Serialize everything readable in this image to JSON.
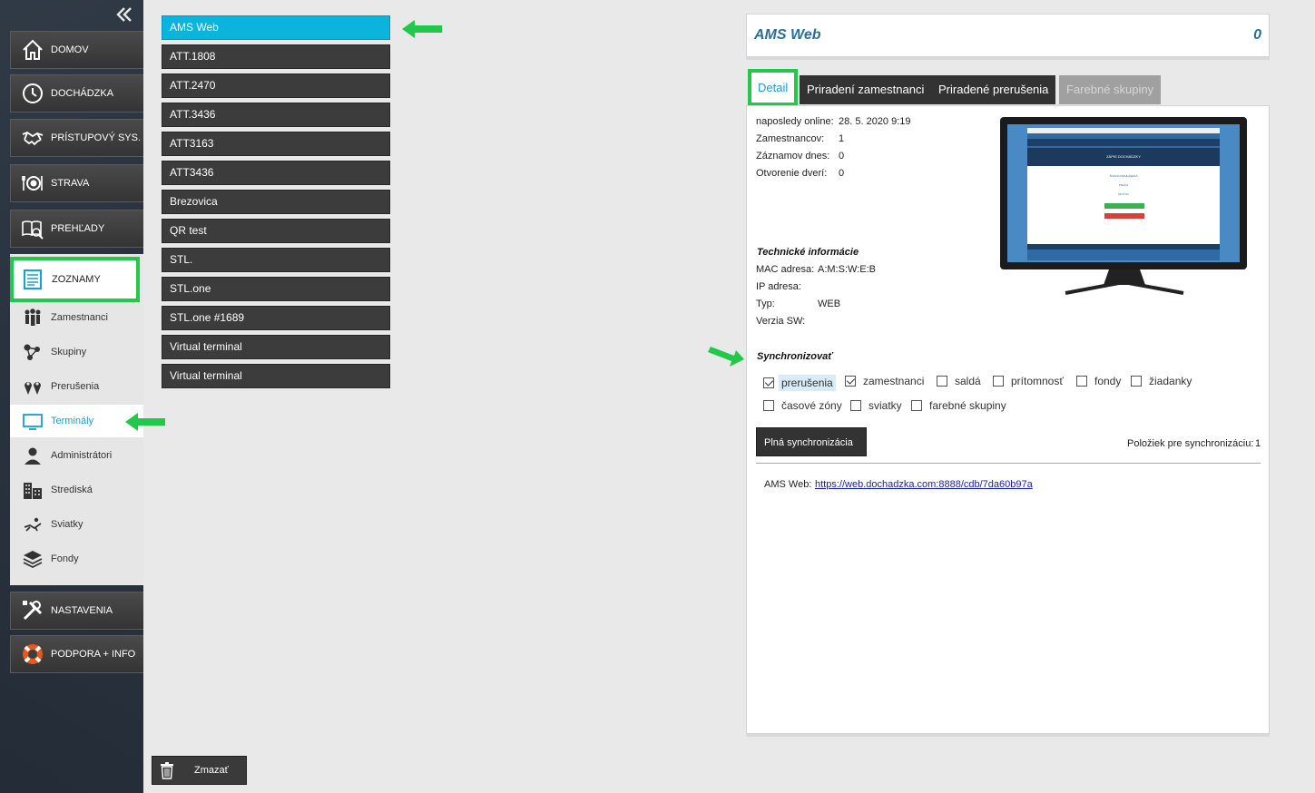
{
  "sidebar": {
    "collapse_icon": "double-chevron-left-icon",
    "nav": [
      {
        "label": "DOMOV",
        "icon": "house-icon"
      },
      {
        "label": "DOCHÁDZKA",
        "icon": "clock-icon"
      },
      {
        "label": "PRÍSTUPOVÝ SYS.",
        "icon": "handshake-icon"
      },
      {
        "label": "STRAVA",
        "icon": "plate-cutlery-icon"
      },
      {
        "label": "PREHĽADY",
        "icon": "book-magnifier-icon"
      }
    ],
    "zoznamy": {
      "label": "ZOZNAMY",
      "icon": "list-document-icon"
    },
    "sub_items": [
      {
        "label": "Zamestnanci",
        "icon": "people-icon"
      },
      {
        "label": "Skupiny",
        "icon": "group-nodes-icon"
      },
      {
        "label": "Prerušenia",
        "icon": "location-pins-icon"
      },
      {
        "label": "Terminály",
        "icon": "monitor-icon"
      },
      {
        "label": "Administrátori",
        "icon": "admin-user-icon"
      },
      {
        "label": "Strediská",
        "icon": "buildings-icon"
      },
      {
        "label": "Sviatky",
        "icon": "lounger-icon"
      },
      {
        "label": "Fondy",
        "icon": "layers-icon"
      }
    ],
    "bottom_nav": [
      {
        "label": "NASTAVENIA",
        "icon": "tools-icon"
      },
      {
        "label": "PODPORA + INFO",
        "icon": "lifebuoy-icon"
      }
    ]
  },
  "terminals": [
    "AMS Web",
    "ATT.1808",
    "ATT.2470",
    "ATT.3436",
    "ATT3163",
    "ATT3436",
    "Brezovica",
    "QR test",
    "STL.",
    "STL.one",
    "STL.one #1689",
    "Virtual terminal",
    "Virtual terminal"
  ],
  "delete_button": {
    "label": "Zmazať",
    "icon": "trash-icon"
  },
  "detail": {
    "title": "AMS Web",
    "count": "0",
    "tabs": [
      "Detail",
      "Priradení zamestnanci",
      "Priradené prerušenia",
      "Farebné skupiny"
    ],
    "info": {
      "last_online_label": "naposledy online:",
      "last_online_value": "28. 5. 2020 9:19",
      "employees_label": "Zamestnancov:",
      "employees_value": "1",
      "records_label": "Záznamov dnes:",
      "records_value": "0",
      "doors_label": "Otvorenie dverí:",
      "doors_value": "0"
    },
    "tech": {
      "heading": "Technické informácie",
      "mac_label": "MAC adresa:",
      "mac_value": "A:M:S:W:E:B",
      "ip_label": "IP adresa:",
      "ip_value": "",
      "type_label": "Typ:",
      "type_value": "WEB",
      "sw_label": "Verzia SW:",
      "sw_value": ""
    },
    "sync": {
      "heading": "Synchronizovať",
      "options_row1": [
        {
          "label": "prerušenia",
          "checked": true
        },
        {
          "label": "zamestnanci",
          "checked": true
        },
        {
          "label": "saldá",
          "checked": false
        },
        {
          "label": "prítomnosť",
          "checked": false
        },
        {
          "label": "fondy",
          "checked": false
        },
        {
          "label": "žiadanky",
          "checked": false
        }
      ],
      "options_row2": [
        {
          "label": "časové zóny",
          "checked": false
        },
        {
          "label": "sviatky",
          "checked": false
        },
        {
          "label": "farebné skupiny",
          "checked": false
        }
      ],
      "full_sync_label": "Plná synchronizácia",
      "items_label": "Položiek pre synchronizáciu:",
      "items_value": "1"
    },
    "url_label": "AMS Web:",
    "url_value": "https://web.dochadzka.com:8888/cdb/7da60b97a",
    "screen": {
      "header_text": "ZÁPIS DOCHÁDZKY",
      "status_text": "ŽIADNA PRIHLÁSENÁ",
      "label": "PRÁCA",
      "time": "09:37:01"
    }
  },
  "colors": {
    "accent": "#0ab4dd",
    "highlight": "#22c84a",
    "title_text": "#2c6f94",
    "sidebar_bg": "#2a3440"
  }
}
